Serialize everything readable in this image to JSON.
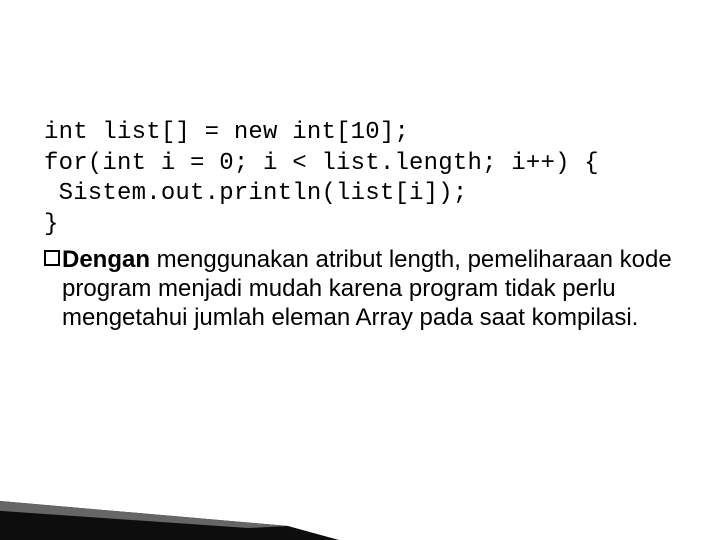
{
  "code": {
    "l1": "int list[] = new int[10];",
    "l2": "for(int i = 0; i < list.length; i++) {",
    "l3": " Sistem.out.println(list[i]);",
    "l4": "}"
  },
  "body": {
    "lead": "Dengan",
    "rest": " menggunakan atribut length, pemeliharaan kode program menjadi mudah karena program tidak perlu mengetahui jumlah eleman Array pada saat kompilasi."
  }
}
